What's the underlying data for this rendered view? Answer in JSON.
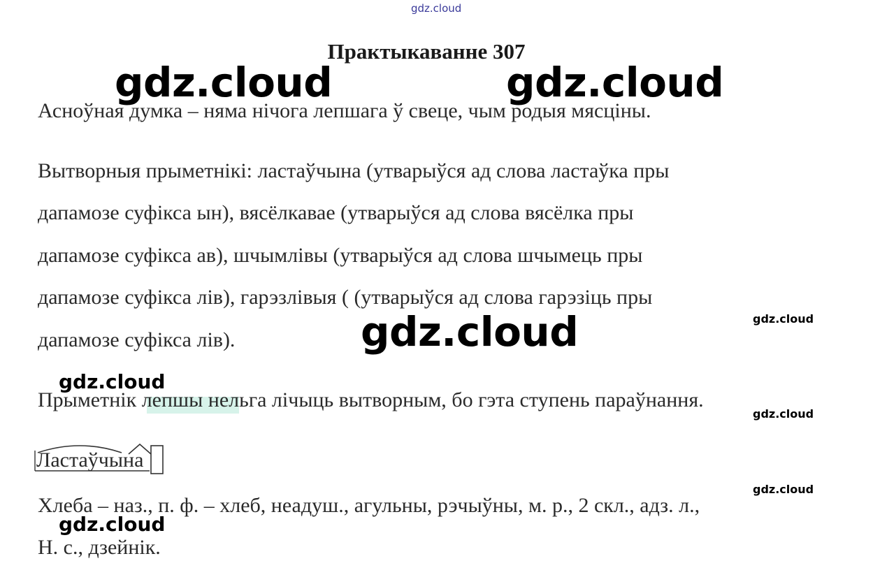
{
  "watermarks": {
    "top": "gdz.cloud",
    "large_left": "gdz.cloud",
    "large_right": "gdz.cloud",
    "large_center": "gdz.cloud",
    "small_right_1": "gdz.cloud",
    "medium_left_1": "gdz.cloud",
    "small_right_2": "gdz.cloud",
    "small_right_3": "gdz.cloud",
    "medium_left_2": "gdz.cloud"
  },
  "title": "Практыкаванне 307",
  "lines": {
    "main_idea": "Асноўная думка – няма нічога лепшага ў свеце, чым родыя мясціны.",
    "derived_1": "Вытворныя прыметнікі: ластаўчына (утварыўся ад слова ластаўка пры",
    "derived_2": "дапамозе суфікса ын), вясёлкавае (утварыўся ад слова вясёлка пры",
    "derived_3": "дапамозе суфікса ав), шчымлівы (утварыўся ад слова шчымець пры",
    "derived_4": "дапамозе суфікса лів), гарэзлівыя ( (утварыўся ад слова гарэзіць пры",
    "derived_5": "дапамозе суфікса лів).",
    "comparative": "Прыметнік лепшы нельга лічыць вытворным, бо гэта ступень параўнання.",
    "parse_1": "Хлеба – наз., п. ф. – хлеб, неадуш., агульны, рэчыўны, м. р., 2 скл., адз. л.,",
    "parse_2": "Н. с., дзейнік."
  },
  "morpheme": {
    "root": "Ластаўч",
    "suffix": "ын",
    "ending": "а"
  }
}
